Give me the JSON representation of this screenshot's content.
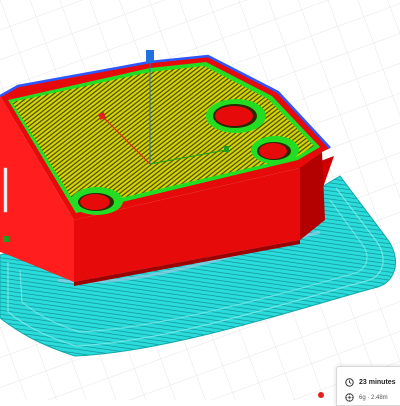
{
  "print_info": {
    "time": "23 minutes",
    "material": "6g · 2.48m",
    "time_icon": "clock-icon",
    "material_icon": "spool-icon"
  },
  "colors": {
    "skirt_brim": "#2bdcdc",
    "outer_wall": "#e60a0a",
    "inner_wall": "#22dd22",
    "top_skin_infill": "#d6d600",
    "skin_lines": "#3a3a00",
    "build_plate_grid": "#e4e4e4",
    "x_axis": "#e32020",
    "y_axis": "#1e9e1e",
    "z_axis": "#2070e0",
    "top_edge": "#2d58ff"
  }
}
